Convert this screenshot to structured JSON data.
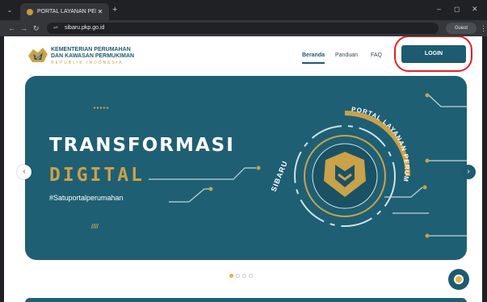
{
  "browser": {
    "tab_title": "PORTAL LAYANAN PERUMAHAN",
    "tab_close_glyph": "✕",
    "new_tab_glyph": "+",
    "tab_menu_glyph": "⌄",
    "minimize_glyph": "–",
    "maximize_glyph": "◻",
    "close_glyph": "✕",
    "back_glyph": "←",
    "forward_glyph": "→",
    "reload_glyph": "↻",
    "site_info_glyph": "⇌",
    "url": "sibaru.pkp.go.id",
    "profile_label": "Guest",
    "menu_glyph": "⋮"
  },
  "header": {
    "brand_line1": "KEMENTERIAN PERUMAHAN",
    "brand_line2": "DAN KAWASAN PERMUKIMAN",
    "brand_line3": "REPUBLIK INDONESIA",
    "nav": [
      "Beranda",
      "Panduan",
      "FAQ"
    ],
    "active_nav": "Beranda",
    "login_label": "LOGIN"
  },
  "banner": {
    "arrows": "▸▸▸▸▸",
    "headline_line1": "TRANSFORMASI",
    "headline_line2": "DIGITAL",
    "hashtag": "#Satuportalperumahan",
    "slashes": "////",
    "emblem_left_text": "SIBARU",
    "emblem_arc_text": "PORTAL LAYANAN PERUMAHAN",
    "prev_glyph": "‹",
    "next_glyph": "›"
  },
  "carousel": {
    "slide_count": 4,
    "active_index": 0
  },
  "colors": {
    "teal": "#1f5f73",
    "gold": "#c9a24a",
    "highlight": "#e32222",
    "backdrop": "#e6d7a3"
  },
  "icons": [
    "tab-search-icon",
    "favicon",
    "reload-icon",
    "site-info-icon",
    "guest-profile-icon",
    "chat-support-icon"
  ]
}
